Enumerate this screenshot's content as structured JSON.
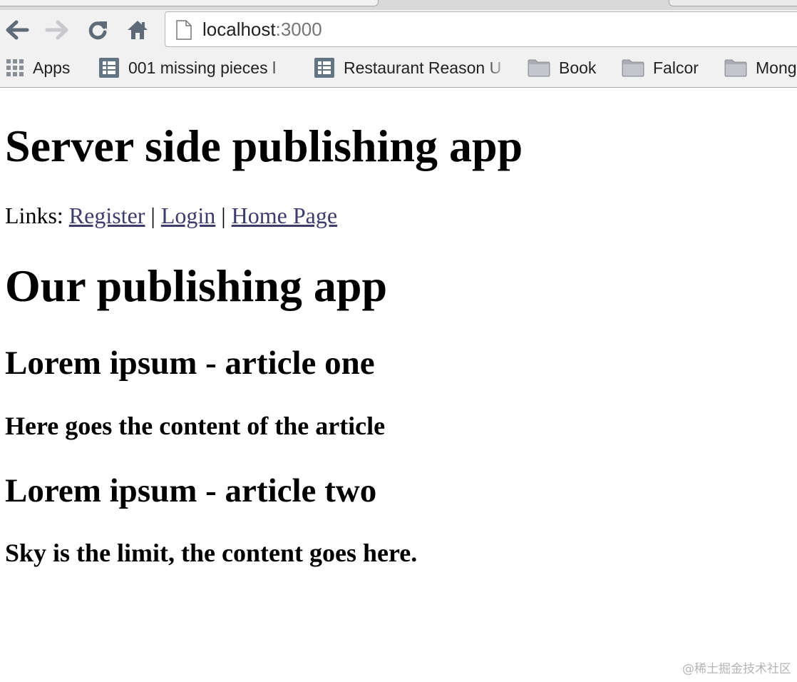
{
  "browser": {
    "url_host": "localhost",
    "url_port": ":3000",
    "bookmarks": [
      {
        "label": "Apps",
        "icon": "apps-grid-icon"
      },
      {
        "label": "001 missing pieces l",
        "icon": "spreadsheet-icon"
      },
      {
        "label": "Restaurant Reason U",
        "icon": "spreadsheet-icon"
      },
      {
        "label": "Book",
        "icon": "folder-icon"
      },
      {
        "label": "Falcor",
        "icon": "folder-icon"
      },
      {
        "label": "Mong",
        "icon": "folder-icon"
      }
    ]
  },
  "page": {
    "title": "Server side publishing app",
    "links_prefix": "Links: ",
    "links": [
      "Register",
      "Login",
      "Home Page"
    ],
    "separator": " | ",
    "heading": "Our publishing app",
    "articles": [
      {
        "title": "Lorem ipsum - article one",
        "content": "Here goes the content of the article"
      },
      {
        "title": "Lorem ipsum - article two",
        "content": "Sky is the limit, the content goes here."
      }
    ]
  },
  "watermark": "@稀土掘金技术社区"
}
